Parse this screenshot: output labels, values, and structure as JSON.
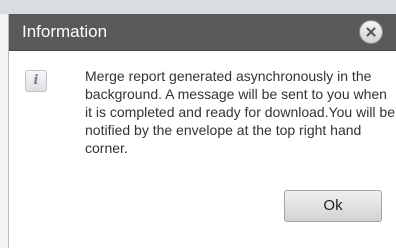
{
  "dialog": {
    "title": "Information",
    "message": "Merge report generated asynchronously in the background. A message will be sent to you when it is completed and ready for download.You will be notified by the envelope at the top right hand corner.",
    "ok_label": "Ok",
    "close_icon": "close-icon",
    "info_icon": "info-icon",
    "info_glyph": "i"
  },
  "colors": {
    "titlebar": "#595959",
    "title_text": "#ffffff",
    "button_face": "#e2e2e2",
    "body_text": "#333333"
  }
}
